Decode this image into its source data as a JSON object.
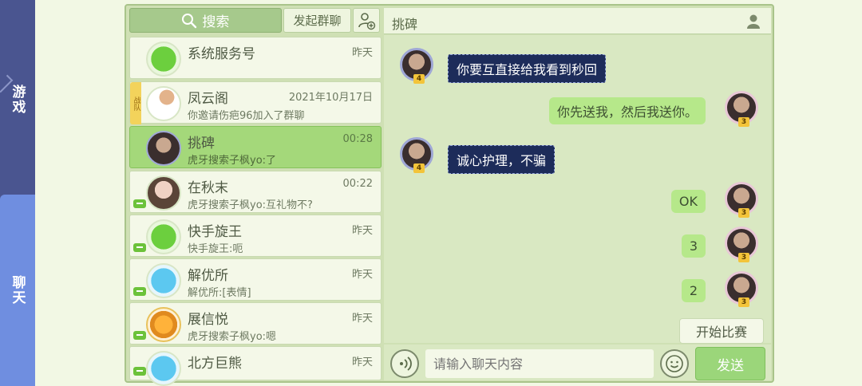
{
  "rail": {
    "game_label": "游戏",
    "chat_label": "聊天"
  },
  "toolbar": {
    "search_label": "搜索",
    "group_chat_label": "发起群聊"
  },
  "conversations": [
    {
      "name": "系统服务号",
      "msg": "",
      "time": "昨天"
    },
    {
      "name": "凤云阁",
      "msg": "你邀请伤疤96加入了群聊",
      "time": "2021年10月17日",
      "clan": "战队"
    },
    {
      "name": "挑碑",
      "msg": "虎牙搜索子枫yo:了",
      "time": "00:28",
      "level": "4"
    },
    {
      "name": "在秋末",
      "msg": "虎牙搜索子枫yo:互礼物不?",
      "time": "00:22"
    },
    {
      "name": "快手旋王",
      "msg": "快手旋王:呃",
      "time": "昨天"
    },
    {
      "name": "解优所",
      "msg": "解优所:[表情]",
      "time": "昨天"
    },
    {
      "name": "展信悦",
      "msg": "虎牙搜索子枫yo:嗯",
      "time": "昨天"
    },
    {
      "name": "北方巨熊",
      "msg": "",
      "time": "昨天"
    }
  ],
  "chat": {
    "title": "挑碑",
    "messages": [
      {
        "side": "left",
        "text": "你要互直接给我看到秒回",
        "level": "4"
      },
      {
        "side": "right",
        "text": "你先送我，然后我送你。",
        "level": "3"
      },
      {
        "side": "left",
        "text": "诚心护理，不骗",
        "level": "4"
      },
      {
        "side": "right",
        "text": "OK",
        "level": "3"
      },
      {
        "side": "right",
        "text": "3",
        "level": "3"
      },
      {
        "side": "right",
        "text": "2",
        "level": "3"
      }
    ],
    "start_match_label": "开始比赛",
    "input_placeholder": "请输入聊天内容",
    "send_label": "发送"
  },
  "colors": {
    "accent": "#a4d87a",
    "rail": "#4a5590",
    "rail_active": "#6f8ee0"
  }
}
